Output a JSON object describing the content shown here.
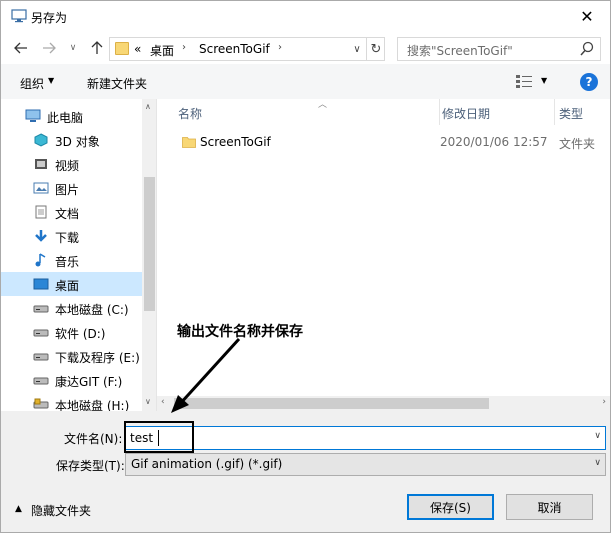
{
  "window": {
    "title": "另存为",
    "close_label": "✕"
  },
  "address": {
    "overflow": "«",
    "crumbs": [
      "桌面",
      "ScreenToGif"
    ],
    "search_placeholder": "搜索\"ScreenToGif\""
  },
  "toolbar": {
    "organize": "组织",
    "new_folder": "新建文件夹",
    "help": "?"
  },
  "nav": {
    "items": [
      {
        "label": "此电脑",
        "icon": "computer-icon"
      },
      {
        "label": "3D 对象",
        "icon": "cube-icon"
      },
      {
        "label": "视频",
        "icon": "video-icon"
      },
      {
        "label": "图片",
        "icon": "picture-icon"
      },
      {
        "label": "文档",
        "icon": "document-icon"
      },
      {
        "label": "下载",
        "icon": "download-icon"
      },
      {
        "label": "音乐",
        "icon": "music-icon"
      },
      {
        "label": "桌面",
        "icon": "desktop-icon"
      },
      {
        "label": "本地磁盘 (C:)",
        "icon": "drive-icon"
      },
      {
        "label": "软件 (D:)",
        "icon": "drive-icon"
      },
      {
        "label": "下载及程序 (E:)",
        "icon": "drive-icon"
      },
      {
        "label": "康达GIT (F:)",
        "icon": "drive-icon"
      },
      {
        "label": "本地磁盘 (H:)",
        "icon": "locked-drive-icon"
      }
    ],
    "selected": "桌面"
  },
  "filelist": {
    "columns": {
      "name": "名称",
      "date": "修改日期",
      "type": "类型"
    },
    "rows": [
      {
        "name": "ScreenToGif",
        "date": "2020/01/06 12:57",
        "type": "文件夹"
      }
    ]
  },
  "annotation": "输出文件名称并保存",
  "form": {
    "filename_label": "文件名(N):",
    "filename_value": "test",
    "filetype_label": "保存类型(T):",
    "filetype_value": "Gif animation (.gif) (*.gif)"
  },
  "footer": {
    "hide_folders": "隐藏文件夹",
    "save": "保存(S)",
    "cancel": "取消"
  },
  "colors": {
    "accent": "#0078d7",
    "selected_bg": "#cce8ff",
    "help_blue": "#1a73d9"
  }
}
